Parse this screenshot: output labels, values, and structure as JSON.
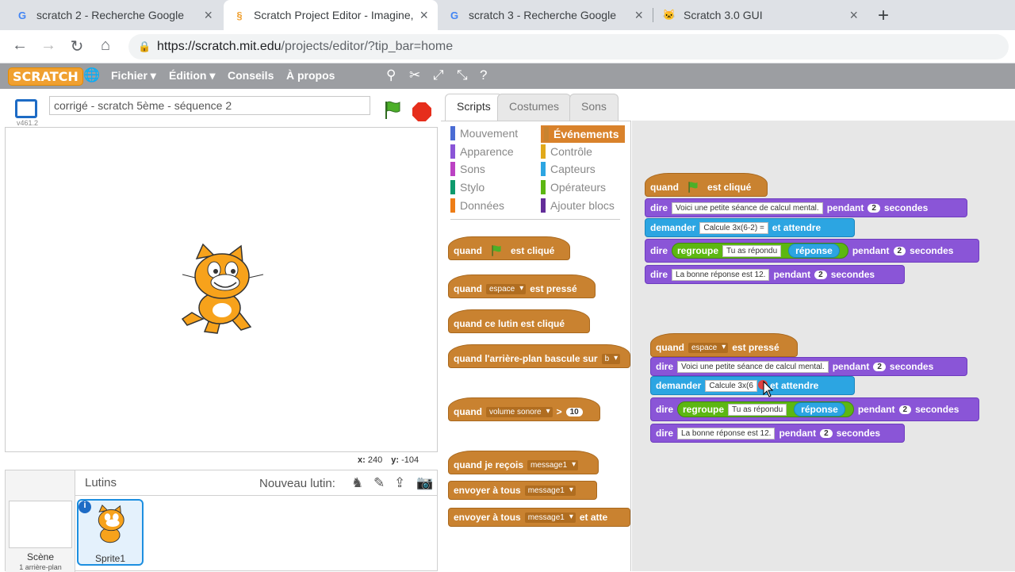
{
  "browser": {
    "tabs": [
      {
        "title": "scratch 2 - Recherche Google",
        "icon": "google-icon"
      },
      {
        "title": "Scratch Project Editor - Imagine,",
        "icon": "scratch-icon"
      },
      {
        "title": "scratch 3 - Recherche Google",
        "icon": "google-icon"
      },
      {
        "title": "Scratch 3.0 GUI",
        "icon": "scratch-cat-icon"
      }
    ],
    "url_host": "https://scratch.mit.edu",
    "url_path": "/projects/editor/?tip_bar=home"
  },
  "menubar": {
    "logo": "SCRATCH",
    "items": [
      "Fichier ▾",
      "Édition ▾",
      "Conseils",
      "À propos"
    ]
  },
  "stage": {
    "project_title": "corrigé - scratch 5ème - séquence 2",
    "version": "v461.2",
    "x_label": "x:",
    "x_value": "240",
    "y_label": "y:",
    "y_value": "-104"
  },
  "sprites": {
    "header": "Lutins",
    "new_sprite": "Nouveau lutin:",
    "scene_label": "Scène",
    "scene_sub": "1 arrière-plan",
    "sprite_name": "Sprite1",
    "info": "i"
  },
  "tabs": [
    "Scripts",
    "Costumes",
    "Sons"
  ],
  "categories": {
    "left": [
      {
        "label": "Mouvement",
        "color": "#4a6cd4"
      },
      {
        "label": "Apparence",
        "color": "#8a55d7"
      },
      {
        "label": "Sons",
        "color": "#bb42c3"
      },
      {
        "label": "Stylo",
        "color": "#0e9a6c"
      },
      {
        "label": "Données",
        "color": "#ee7d16"
      }
    ],
    "right": [
      {
        "label": "Événements",
        "color": "#c88330"
      },
      {
        "label": "Contrôle",
        "color": "#e1a91a"
      },
      {
        "label": "Capteurs",
        "color": "#2ca5e2"
      },
      {
        "label": "Opérateurs",
        "color": "#5cb712"
      },
      {
        "label": "Ajouter blocs",
        "color": "#632d99"
      }
    ]
  },
  "palette_blocks": {
    "when_flag": [
      "quand",
      "est cliqué"
    ],
    "when_key": [
      "quand",
      "espace",
      "est pressé"
    ],
    "when_sprite": "quand ce lutin est cliqué",
    "when_backdrop": "quand l'arrière-plan bascule sur",
    "when_backdrop_field": "b",
    "when_loudness": [
      "quand",
      "volume sonore",
      ">",
      "10"
    ],
    "when_receive": [
      "quand je reçois",
      "message1"
    ],
    "broadcast": [
      "envoyer à tous",
      "message1"
    ],
    "broadcast_wait": [
      "envoyer à tous",
      "message1",
      "et atte"
    ]
  },
  "script1": {
    "hat": [
      "quand",
      "est cliqué"
    ],
    "say1": [
      "dire",
      "Voici une petite séance de calcul mental.",
      "pendant",
      "2",
      "secondes"
    ],
    "ask": [
      "demander",
      "Calcule 3x(6-2) =",
      "et attendre"
    ],
    "say2": [
      "dire",
      "regroupe",
      "Tu as répondu",
      "réponse",
      "pendant",
      "2",
      "secondes"
    ],
    "say3": [
      "dire",
      "La bonne réponse est 12.",
      "pendant",
      "2",
      "secondes"
    ]
  },
  "script2": {
    "hat": [
      "quand",
      "espace",
      "est pressé"
    ],
    "say1": [
      "dire",
      "Voici une petite séance de calcul mental.",
      "pendant",
      "2",
      "secondes"
    ],
    "ask": [
      "demander",
      "Calcule 3x(6",
      "=",
      "et attendre"
    ],
    "say2": [
      "dire",
      "regroupe",
      "Tu as répondu",
      "réponse",
      "pendant",
      "2",
      "secondes"
    ],
    "say3": [
      "dire",
      "La bonne réponse est 12.",
      "pendant",
      "2",
      "secondes"
    ]
  }
}
